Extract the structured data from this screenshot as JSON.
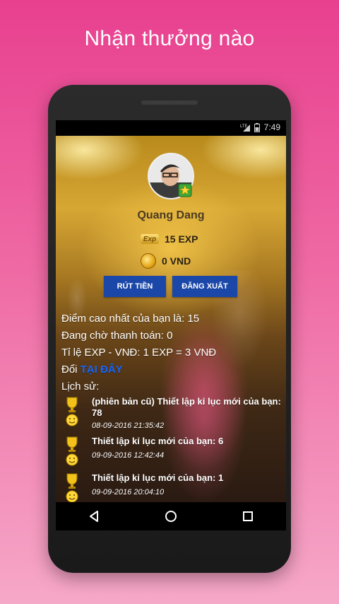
{
  "promo": {
    "title": "Nhận thưởng nào"
  },
  "status_bar": {
    "time": "7:49",
    "network": "LTE"
  },
  "profile": {
    "username": "Quang Dang",
    "exp_icon_label": "Exp",
    "exp": "15 EXP",
    "vnd": "0 VND"
  },
  "actions": {
    "withdraw_label": "RÚT TIỀN",
    "logout_label": "ĐĂNG XUẤT"
  },
  "info": {
    "high_score": "Điểm cao nhất của bạn là: 15",
    "pending": "Đang chờ thanh toán: 0",
    "rate": "Tỉ lệ EXP - VNĐ: 1 EXP = 3 VNĐ",
    "exchange_prefix": "Đổi ",
    "exchange_link": "TẠI ĐÂY",
    "history_heading": "Lịch sử:"
  },
  "history": [
    {
      "title": "(phiên bản cũ) Thiết lập kỉ lục mới của bạn: 78",
      "date": "08-09-2016 21:35:42"
    },
    {
      "title": "Thiết lập kỉ lục mới của bạn: 6",
      "date": "09-09-2016 12:42:44"
    },
    {
      "title": "Thiết lập kỉ lục mới của bạn: 1",
      "date": "09-09-2016 20:04:10"
    }
  ],
  "colors": {
    "background": "#e8408f",
    "button": "#1a47a8",
    "link": "#1565ff"
  }
}
